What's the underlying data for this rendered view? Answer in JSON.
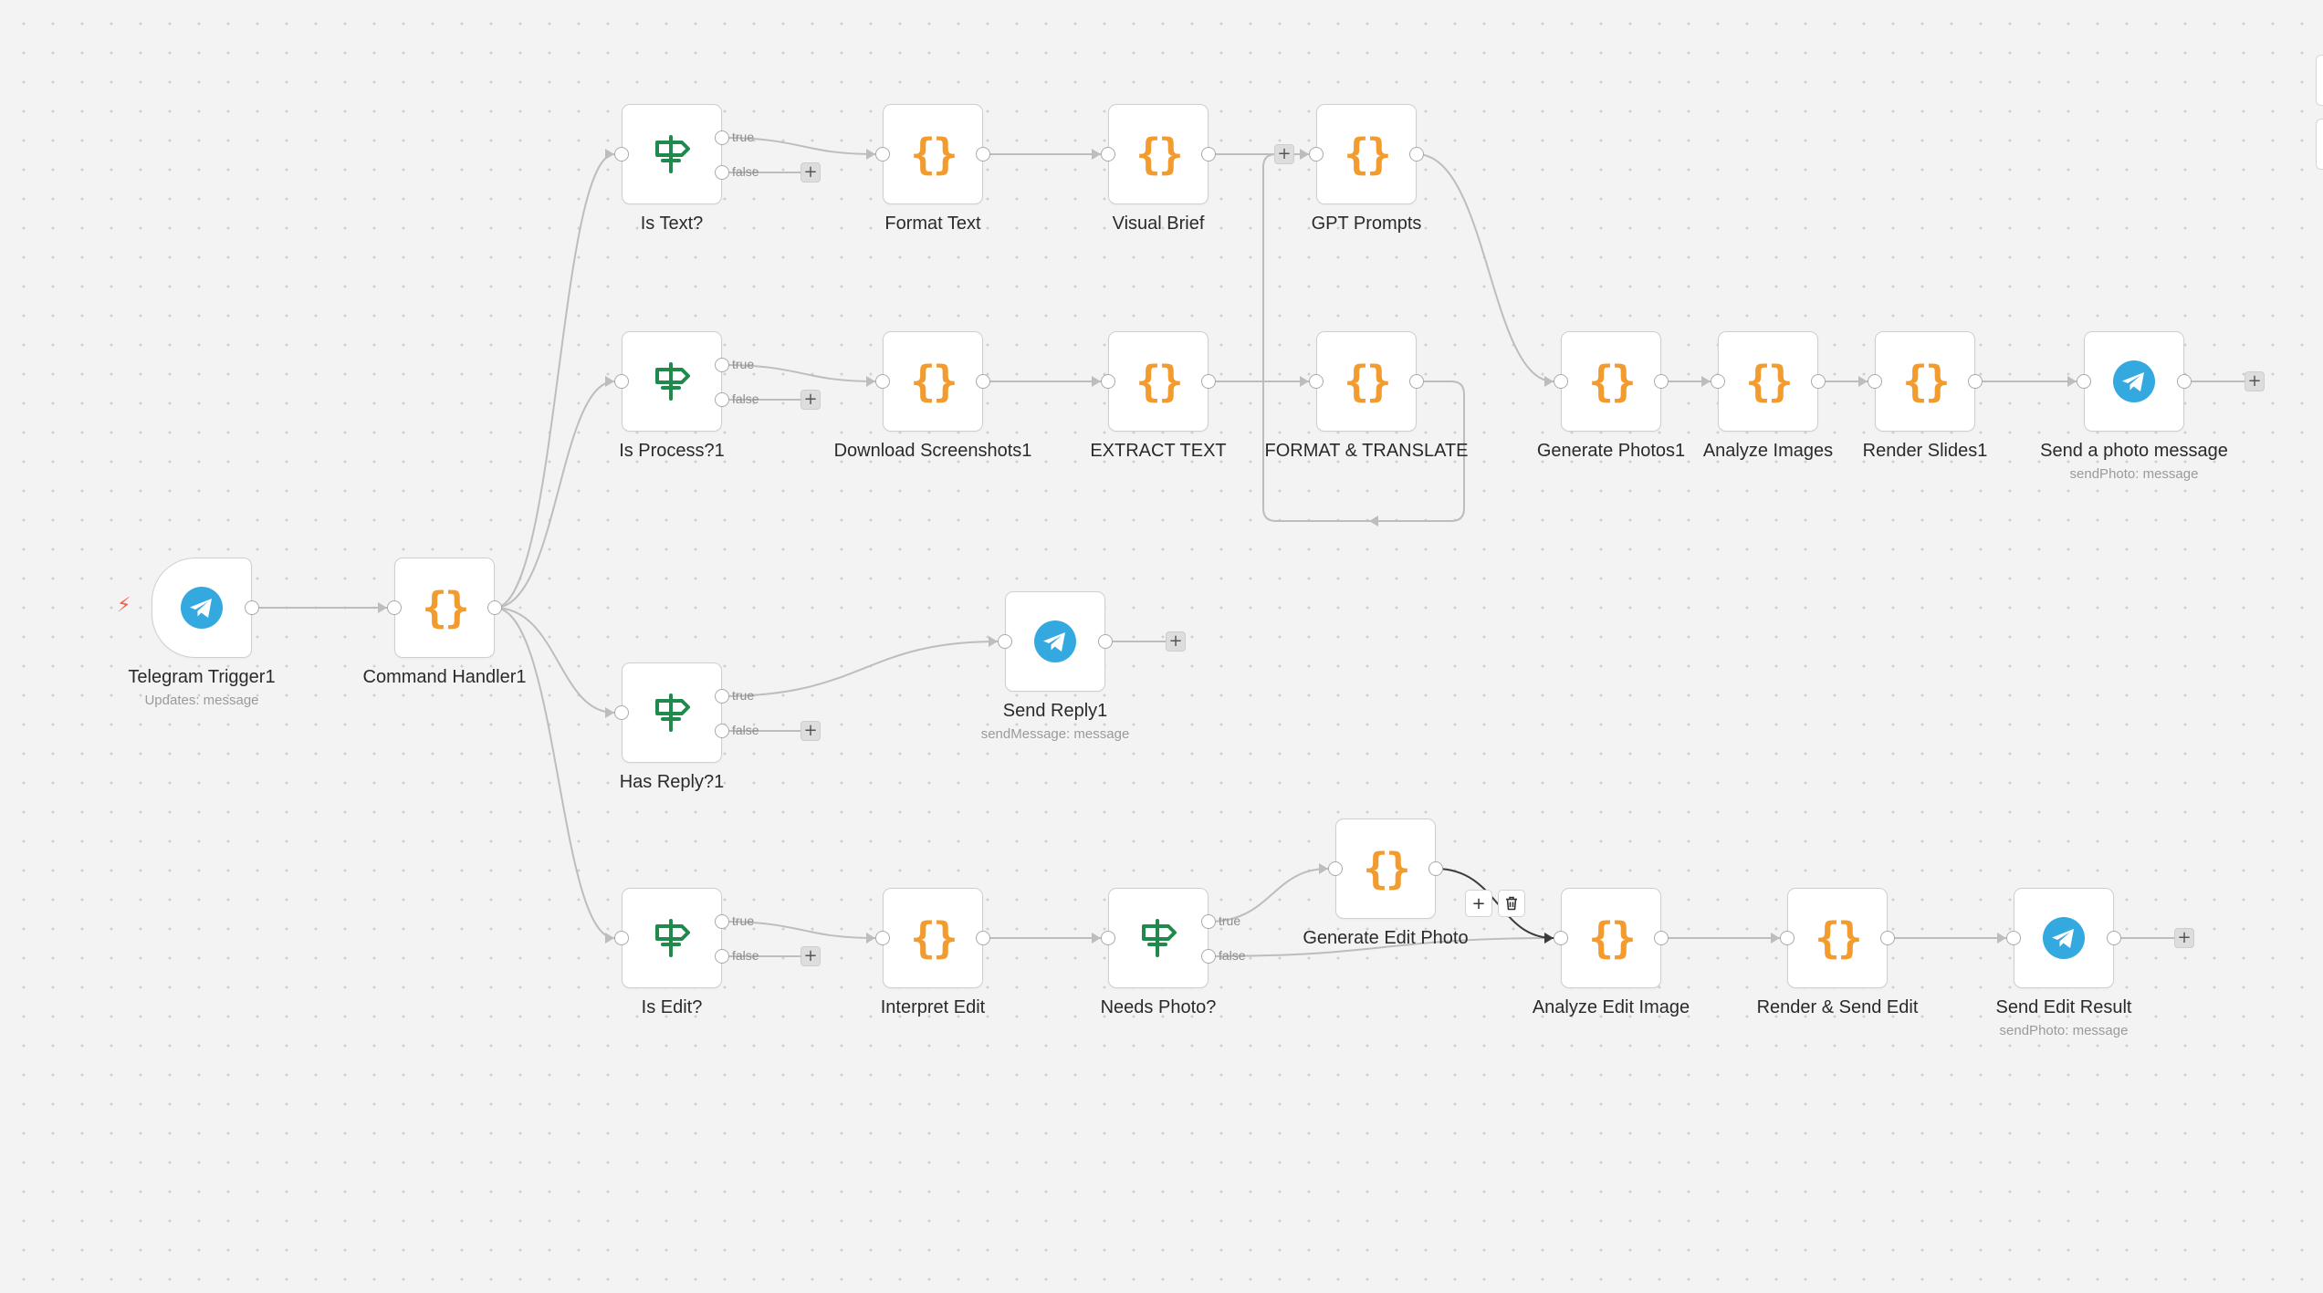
{
  "canvas": {
    "nodes": [
      {
        "id": "telegram_trigger",
        "name": "telegram-trigger-node",
        "kind": "telegram",
        "label": "Telegram Trigger1",
        "sublabel": "Updates: message"
      },
      {
        "id": "command_handler",
        "name": "command-handler-node",
        "kind": "code",
        "label": "Command Handler1",
        "sublabel": ""
      },
      {
        "id": "is_text",
        "name": "is-text-node",
        "kind": "if",
        "label": "Is Text?",
        "sublabel": ""
      },
      {
        "id": "format_text",
        "name": "format-text-node",
        "kind": "code",
        "label": "Format Text",
        "sublabel": ""
      },
      {
        "id": "visual_brief",
        "name": "visual-brief-node",
        "kind": "code",
        "label": "Visual Brief",
        "sublabel": ""
      },
      {
        "id": "gpt_prompts",
        "name": "gpt-prompts-node",
        "kind": "code",
        "label": "GPT Prompts",
        "sublabel": ""
      },
      {
        "id": "is_process",
        "name": "is-process-node",
        "kind": "if",
        "label": "Is Process?1",
        "sublabel": ""
      },
      {
        "id": "download_screenshots",
        "name": "download-screenshots-node",
        "kind": "code",
        "label": "Download Screenshots1",
        "sublabel": ""
      },
      {
        "id": "extract_text",
        "name": "extract-text-node",
        "kind": "code",
        "label": "EXTRACT TEXT",
        "sublabel": ""
      },
      {
        "id": "format_translate",
        "name": "format-translate-node",
        "kind": "code",
        "label": "FORMAT & TRANSLATE",
        "sublabel": ""
      },
      {
        "id": "generate_photos",
        "name": "generate-photos-node",
        "kind": "code",
        "label": "Generate Photos1",
        "sublabel": ""
      },
      {
        "id": "analyze_images",
        "name": "analyze-images-node",
        "kind": "code",
        "label": "Analyze Images",
        "sublabel": ""
      },
      {
        "id": "render_slides",
        "name": "render-slides-node",
        "kind": "code",
        "label": "Render Slides1",
        "sublabel": ""
      },
      {
        "id": "send_photo_message",
        "name": "send-photo-message-node",
        "kind": "telegram",
        "label": "Send a photo message",
        "sublabel": "sendPhoto: message"
      },
      {
        "id": "has_reply",
        "name": "has-reply-node",
        "kind": "if",
        "label": "Has Reply?1",
        "sublabel": ""
      },
      {
        "id": "send_reply",
        "name": "send-reply-node",
        "kind": "telegram",
        "label": "Send Reply1",
        "sublabel": "sendMessage: message"
      },
      {
        "id": "is_edit",
        "name": "is-edit-node",
        "kind": "if",
        "label": "Is Edit?",
        "sublabel": ""
      },
      {
        "id": "interpret_edit",
        "name": "interpret-edit-node",
        "kind": "code",
        "label": "Interpret Edit",
        "sublabel": ""
      },
      {
        "id": "needs_photo",
        "name": "needs-photo-node",
        "kind": "if",
        "label": "Needs Photo?",
        "sublabel": ""
      },
      {
        "id": "generate_edit_photo",
        "name": "generate-edit-photo-node",
        "kind": "code",
        "label": "Generate Edit Photo",
        "sublabel": ""
      },
      {
        "id": "analyze_edit_image",
        "name": "analyze-edit-image-node",
        "kind": "code",
        "label": "Analyze Edit Image",
        "sublabel": ""
      },
      {
        "id": "render_send_edit",
        "name": "render-send-edit-node",
        "kind": "code",
        "label": "Render & Send Edit",
        "sublabel": ""
      },
      {
        "id": "send_edit_result",
        "name": "send-edit-result-node",
        "kind": "telegram",
        "label": "Send Edit Result",
        "sublabel": "sendPhoto: message"
      }
    ],
    "branch_labels": {
      "true": "true",
      "false": "false"
    },
    "add_button_glyph": "+",
    "edge_toolbar": {
      "add": "+",
      "delete": "🗑"
    },
    "colors": {
      "code_icon": "#f29b2e",
      "if_icon": "#1f8a4c",
      "telegram_icon": "#34a9e0",
      "edge": "#bdbdbd",
      "edge_hover": "#3b3b3b",
      "trigger_bolt": "#f25f4c"
    }
  }
}
